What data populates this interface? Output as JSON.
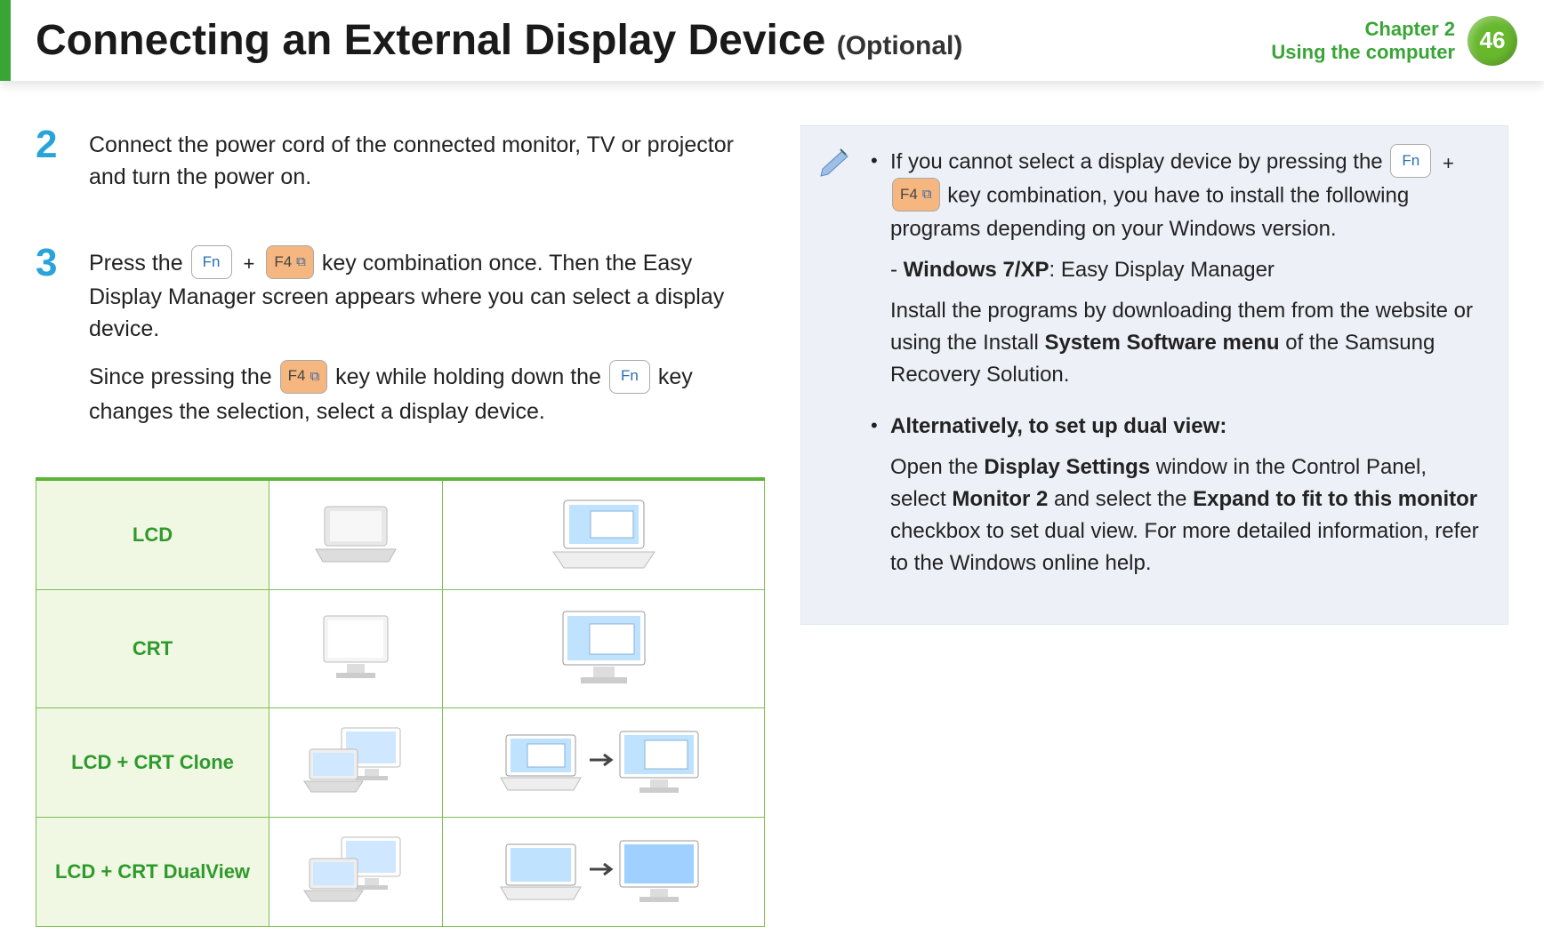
{
  "header": {
    "title": "Connecting an External Display Device",
    "subtitle": "(Optional)",
    "chapter_label": "Chapter 2",
    "chapter_sub": "Using the computer",
    "page_number": "46"
  },
  "keys": {
    "fn": "Fn",
    "f4": "F4",
    "plus": "+"
  },
  "steps": [
    {
      "num": "2",
      "text": "Connect the power cord of the connected monitor, TV or projector and turn the power on."
    },
    {
      "num": "3",
      "p1_a": "Press the ",
      "p1_b": " key combination once. Then the Easy Display Manager screen appears where you can select a display device.",
      "p2_a": "Since pressing the ",
      "p2_b": " key while holding down the ",
      "p2_c": " key changes the selection, select a display device."
    }
  ],
  "table": {
    "rows": [
      {
        "label": "LCD"
      },
      {
        "label": "CRT"
      },
      {
        "label": "LCD + CRT Clone"
      },
      {
        "label": "LCD + CRT DualView"
      }
    ]
  },
  "note": {
    "bullet1_a": "If you cannot select a display device by pressing the ",
    "bullet1_b": " key combination, you have to install the following programs depending on your Windows version.",
    "bullet1_win_label": "Windows 7/XP",
    "bullet1_win_value": ": Easy Display Manager",
    "bullet1_install_a": "Install the programs by downloading them from the website or using the Install ",
    "bullet1_install_bold": "System Software menu",
    "bullet1_install_b": " of the Samsung Recovery Solution.",
    "bullet2_title": "Alternatively, to set up dual view:",
    "bullet2_a": "Open the ",
    "bullet2_bold1": "Display Settings",
    "bullet2_b": " window in the Control Panel, select ",
    "bullet2_bold2": "Monitor 2",
    "bullet2_c": " and select the ",
    "bullet2_bold3": "Expand to fit to this monitor",
    "bullet2_d": " checkbox to set dual view. For more detailed information, refer to the Windows online help."
  }
}
